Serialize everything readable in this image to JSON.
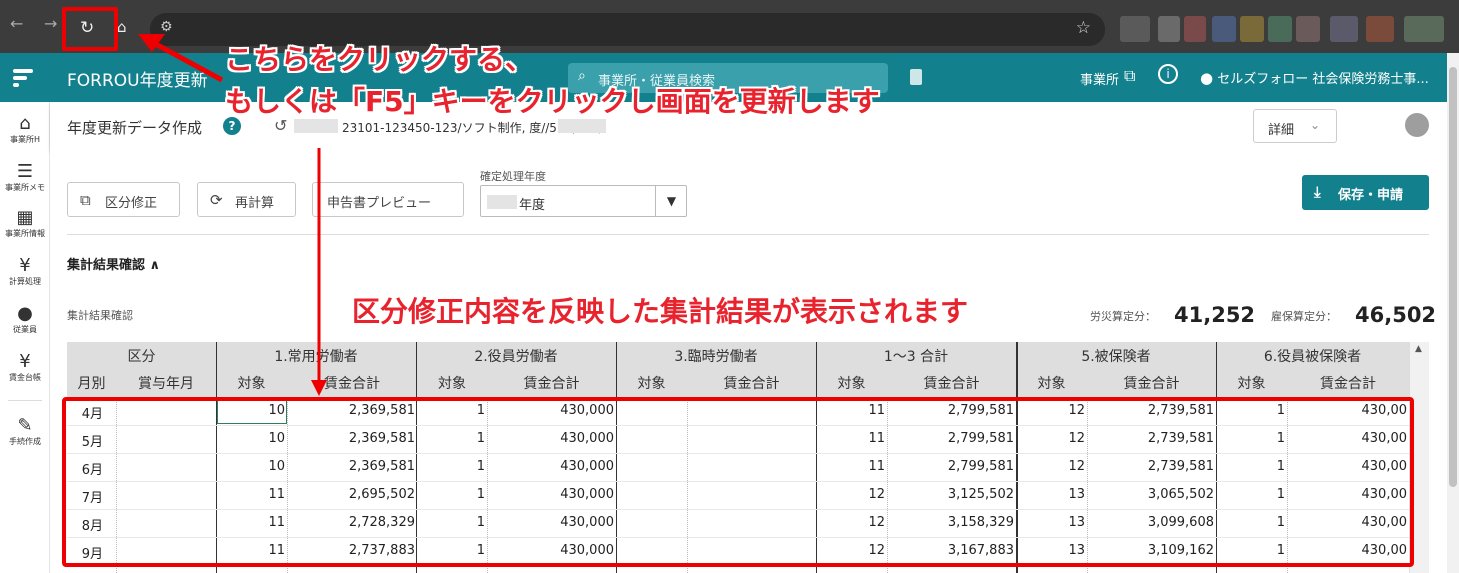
{
  "browser": {
    "back_icon": "arrow-left-icon",
    "forward_icon": "arrow-right-icon",
    "reload_icon": "reload-icon",
    "home_icon": "home-icon",
    "bookmark_icon": "star-icon"
  },
  "app": {
    "title": "FORROU年度更新",
    "search_placeholder": "事業所・従業員検索",
    "office_link": "事業所",
    "user_name": "セルズフォロー 社会保険労務士事..."
  },
  "sidebar": {
    "items": [
      {
        "label": "事業所H",
        "icon": "home-building-icon"
      },
      {
        "label": "事業所メモ",
        "icon": "memo-icon"
      },
      {
        "label": "事業所情報",
        "icon": "building-icon"
      },
      {
        "label": "計算処理",
        "icon": "yen-document-icon"
      },
      {
        "label": "従業員",
        "icon": "person-icon"
      },
      {
        "label": "賃金台帳",
        "icon": "ledger-icon"
      },
      {
        "label": "手続作成",
        "icon": "edit-icon"
      }
    ]
  },
  "subheader": {
    "title": "年度更新データ作成",
    "path": "23101-123450-123/ソフト制作,          度//577,084/",
    "detail_label": "詳細"
  },
  "toolbar": {
    "kubun_label": "区分修正",
    "recalc_label": "再計算",
    "preview_label": "申告書プレビュー",
    "year_label": "確定処理年度",
    "year_value": "年度",
    "save_label": "保存・申請"
  },
  "summary": {
    "section_title": "集計結果確認",
    "subtitle": "集計結果確認",
    "rousai_label": "労災算定分：",
    "rousai_value": "41,252",
    "koyou_label": "雇保算定分：",
    "koyou_value": "46,502"
  },
  "table": {
    "group_headers": [
      "区分",
      "1.常用労働者",
      "2.役員労働者",
      "3.臨時労働者",
      "1〜3 合計",
      "5.被保険者",
      "6.役員被保険者"
    ],
    "sub_headers": [
      "月別",
      "賞与年月",
      "対象",
      "賃金合計",
      "対象",
      "賃金合計",
      "対象",
      "賃金合計",
      "対象",
      "賃金合計",
      "対象",
      "賃金合計",
      "対象",
      "賃金合計"
    ],
    "rows": [
      [
        "4月",
        "",
        "10",
        "2,369,581",
        "1",
        "430,000",
        "",
        "",
        "11",
        "2,799,581",
        "12",
        "2,739,581",
        "1",
        "430,00"
      ],
      [
        "5月",
        "",
        "10",
        "2,369,581",
        "1",
        "430,000",
        "",
        "",
        "11",
        "2,799,581",
        "12",
        "2,739,581",
        "1",
        "430,00"
      ],
      [
        "6月",
        "",
        "10",
        "2,369,581",
        "1",
        "430,000",
        "",
        "",
        "11",
        "2,799,581",
        "12",
        "2,739,581",
        "1",
        "430,00"
      ],
      [
        "7月",
        "",
        "11",
        "2,695,502",
        "1",
        "430,000",
        "",
        "",
        "12",
        "3,125,502",
        "13",
        "3,065,502",
        "1",
        "430,00"
      ],
      [
        "8月",
        "",
        "11",
        "2,728,329",
        "1",
        "430,000",
        "",
        "",
        "12",
        "3,158,329",
        "13",
        "3,099,608",
        "1",
        "430,00"
      ],
      [
        "9月",
        "",
        "11",
        "2,737,883",
        "1",
        "430,000",
        "",
        "",
        "12",
        "3,167,883",
        "13",
        "3,109,162",
        "1",
        "430,00"
      ]
    ]
  },
  "annotations": {
    "line1": "こちらをクリックする、",
    "line2": "もしくは「F5」キーをクリックし画面を更新します",
    "line3": "区分修正内容を反映した集計結果が表示されます",
    "color": "#e8232e"
  }
}
